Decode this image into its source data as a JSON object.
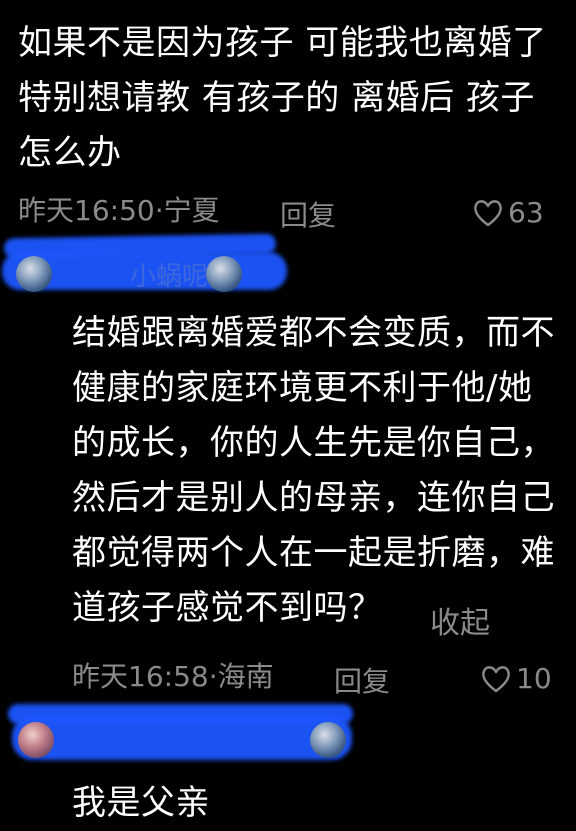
{
  "parent_comment": {
    "lines": [
      "如果不是因为孩子 可能我也离婚了",
      "特别想请教 有孩子的 离婚后 孩子",
      "怎么办"
    ],
    "time": "昨天16:50",
    "separator": "·",
    "location": "宁夏",
    "reply_label": "回复",
    "likes": "63"
  },
  "reply_1": {
    "user_name": "小蜗呢",
    "lines": [
      "结婚跟离婚爱都不会变质，而不",
      "健康的家庭环境更不利于他/她",
      "的成长，你的人生先是你自己，",
      "然后才是别人的母亲，连你自己",
      "都觉得两个人在一起是折磨，难",
      "道孩子感觉不到吗？"
    ],
    "collapse_label": "收起",
    "time": "昨天16:58",
    "separator": "·",
    "location": "海南",
    "reply_label": "回复",
    "likes": "10"
  },
  "reply_2": {
    "lines": [
      "我是父亲"
    ]
  },
  "colors": {
    "background": "#000000",
    "text": "#ffffff",
    "meta": "#8a8a8a",
    "redaction": "#1d57ff"
  },
  "icons": {
    "like": "heart-outline-icon",
    "avatar": "avatar"
  }
}
